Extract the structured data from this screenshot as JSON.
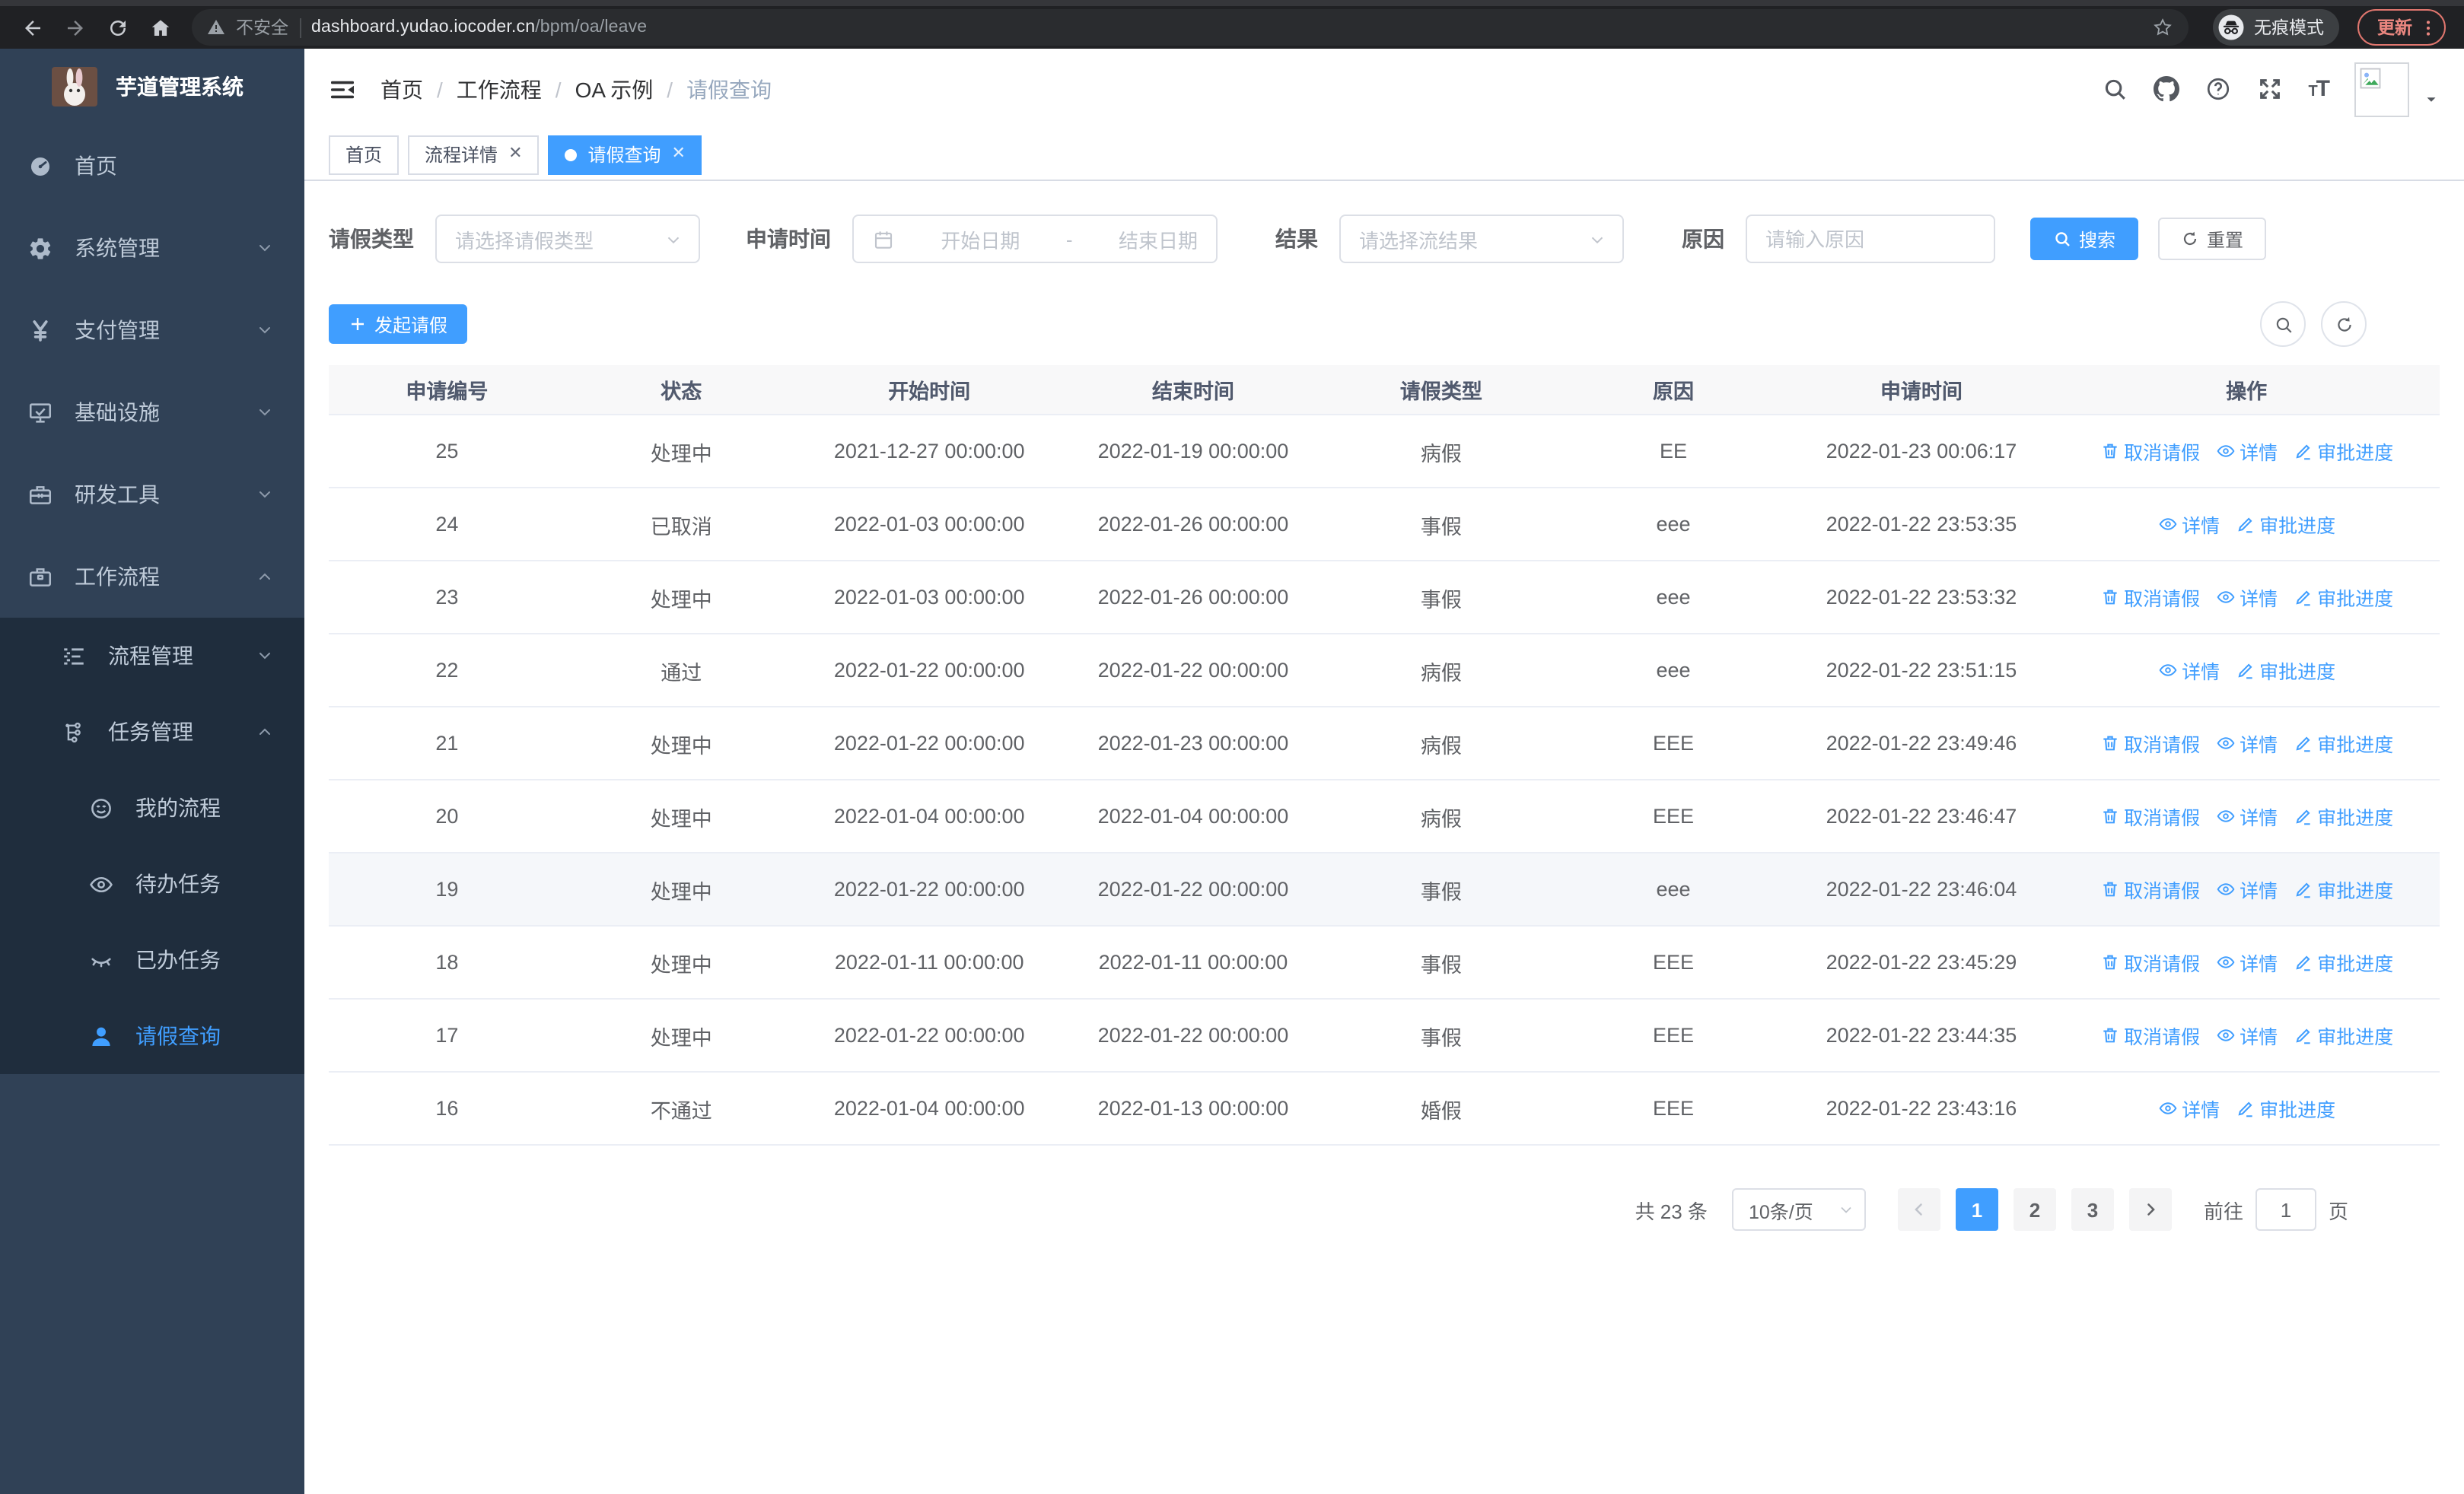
{
  "browser": {
    "security_label": "不安全",
    "url_host": "dashboard.yudao.iocoder.cn",
    "url_path": "/bpm/oa/leave",
    "incognito_label": "无痕模式",
    "update_label": "更新"
  },
  "sidebar": {
    "title": "芋道管理系统",
    "items": [
      {
        "name": "home",
        "label": "首页",
        "icon": "dashboard-icon",
        "level": 1,
        "chevron": "",
        "in_submenu": false,
        "active": false
      },
      {
        "name": "system-mgmt",
        "label": "系统管理",
        "icon": "gear-icon",
        "level": 1,
        "chevron": "down",
        "in_submenu": false,
        "active": false
      },
      {
        "name": "payment-mgmt",
        "label": "支付管理",
        "icon": "yen-icon",
        "level": 1,
        "chevron": "down",
        "in_submenu": false,
        "active": false
      },
      {
        "name": "infrastructure",
        "label": "基础设施",
        "icon": "monitor-icon",
        "level": 1,
        "chevron": "down",
        "in_submenu": false,
        "active": false
      },
      {
        "name": "dev-tools",
        "label": "研发工具",
        "icon": "toolbox-icon",
        "level": 1,
        "chevron": "down",
        "in_submenu": false,
        "active": false
      },
      {
        "name": "workflow",
        "label": "工作流程",
        "icon": "briefcase-icon",
        "level": 1,
        "chevron": "up",
        "in_submenu": false,
        "active": false
      },
      {
        "name": "process-mgmt",
        "label": "流程管理",
        "icon": "list-icon",
        "level": 2,
        "chevron": "down",
        "in_submenu": true,
        "active": false
      },
      {
        "name": "task-mgmt",
        "label": "任务管理",
        "icon": "flow-icon",
        "level": 2,
        "chevron": "up",
        "in_submenu": true,
        "active": false
      },
      {
        "name": "my-process",
        "label": "我的流程",
        "icon": "face-icon",
        "level": 3,
        "chevron": "",
        "in_submenu": true,
        "active": false
      },
      {
        "name": "todo-tasks",
        "label": "待办任务",
        "icon": "eye-icon",
        "level": 3,
        "chevron": "",
        "in_submenu": true,
        "active": false
      },
      {
        "name": "done-tasks",
        "label": "已办任务",
        "icon": "eye-closed-icon",
        "level": 3,
        "chevron": "",
        "in_submenu": true,
        "active": false
      },
      {
        "name": "leave-query",
        "label": "请假查询",
        "icon": "user-icon",
        "level": 3,
        "chevron": "",
        "in_submenu": true,
        "active": true
      }
    ]
  },
  "header": {
    "breadcrumb": [
      "首页",
      "工作流程",
      "OA 示例",
      "请假查询"
    ]
  },
  "tabs": [
    {
      "name": "tab-home",
      "label": "首页",
      "closable": false,
      "active": false
    },
    {
      "name": "tab-process-detail",
      "label": "流程详情",
      "closable": true,
      "active": false
    },
    {
      "name": "tab-leave-query",
      "label": "请假查询",
      "closable": true,
      "active": true
    }
  ],
  "filters": {
    "leave_type_label": "请假类型",
    "leave_type_placeholder": "请选择请假类型",
    "apply_time_label": "申请时间",
    "start_date_placeholder": "开始日期",
    "range_separator": "-",
    "end_date_placeholder": "结束日期",
    "result_label": "结果",
    "result_placeholder": "请选择流结果",
    "reason_label": "原因",
    "reason_placeholder": "请输入原因",
    "search_label": "搜索",
    "reset_label": "重置"
  },
  "toolbar": {
    "create_label": "发起请假"
  },
  "table": {
    "columns": [
      "申请编号",
      "状态",
      "开始时间",
      "结束时间",
      "请假类型",
      "原因",
      "申请时间",
      "操作"
    ],
    "action_labels": {
      "cancel": "取消请假",
      "detail": "详情",
      "progress": "审批进度"
    },
    "rows": [
      {
        "id": "25",
        "status": "处理中",
        "start": "2021-12-27 00:00:00",
        "end": "2022-01-19 00:00:00",
        "type": "病假",
        "reason": "EE",
        "apply_time": "2022-01-23 00:06:17",
        "actions": [
          "cancel",
          "detail",
          "progress"
        ],
        "highlighted": false
      },
      {
        "id": "24",
        "status": "已取消",
        "start": "2022-01-03 00:00:00",
        "end": "2022-01-26 00:00:00",
        "type": "事假",
        "reason": "eee",
        "apply_time": "2022-01-22 23:53:35",
        "actions": [
          "detail",
          "progress"
        ],
        "highlighted": false
      },
      {
        "id": "23",
        "status": "处理中",
        "start": "2022-01-03 00:00:00",
        "end": "2022-01-26 00:00:00",
        "type": "事假",
        "reason": "eee",
        "apply_time": "2022-01-22 23:53:32",
        "actions": [
          "cancel",
          "detail",
          "progress"
        ],
        "highlighted": false
      },
      {
        "id": "22",
        "status": "通过",
        "start": "2022-01-22 00:00:00",
        "end": "2022-01-22 00:00:00",
        "type": "病假",
        "reason": "eee",
        "apply_time": "2022-01-22 23:51:15",
        "actions": [
          "detail",
          "progress"
        ],
        "highlighted": false
      },
      {
        "id": "21",
        "status": "处理中",
        "start": "2022-01-22 00:00:00",
        "end": "2022-01-23 00:00:00",
        "type": "病假",
        "reason": "EEE",
        "apply_time": "2022-01-22 23:49:46",
        "actions": [
          "cancel",
          "detail",
          "progress"
        ],
        "highlighted": false
      },
      {
        "id": "20",
        "status": "处理中",
        "start": "2022-01-04 00:00:00",
        "end": "2022-01-04 00:00:00",
        "type": "病假",
        "reason": "EEE",
        "apply_time": "2022-01-22 23:46:47",
        "actions": [
          "cancel",
          "detail",
          "progress"
        ],
        "highlighted": false
      },
      {
        "id": "19",
        "status": "处理中",
        "start": "2022-01-22 00:00:00",
        "end": "2022-01-22 00:00:00",
        "type": "事假",
        "reason": "eee",
        "apply_time": "2022-01-22 23:46:04",
        "actions": [
          "cancel",
          "detail",
          "progress"
        ],
        "highlighted": true
      },
      {
        "id": "18",
        "status": "处理中",
        "start": "2022-01-11 00:00:00",
        "end": "2022-01-11 00:00:00",
        "type": "事假",
        "reason": "EEE",
        "apply_time": "2022-01-22 23:45:29",
        "actions": [
          "cancel",
          "detail",
          "progress"
        ],
        "highlighted": false
      },
      {
        "id": "17",
        "status": "处理中",
        "start": "2022-01-22 00:00:00",
        "end": "2022-01-22 00:00:00",
        "type": "事假",
        "reason": "EEE",
        "apply_time": "2022-01-22 23:44:35",
        "actions": [
          "cancel",
          "detail",
          "progress"
        ],
        "highlighted": false
      },
      {
        "id": "16",
        "status": "不通过",
        "start": "2022-01-04 00:00:00",
        "end": "2022-01-13 00:00:00",
        "type": "婚假",
        "reason": "EEE",
        "apply_time": "2022-01-22 23:43:16",
        "actions": [
          "detail",
          "progress"
        ],
        "highlighted": false
      }
    ]
  },
  "pagination": {
    "total_label": "共 23 条",
    "page_size_label": "10条/页",
    "pages": [
      "1",
      "2",
      "3"
    ],
    "current_page": "1",
    "goto_label": "前往",
    "goto_value": "1",
    "goto_suffix": "页"
  },
  "colors": {
    "accent": "#409EFF",
    "sidebar_bg": "#304156",
    "submenu_bg": "#1f2d3d",
    "update_accent": "#e9867f"
  }
}
